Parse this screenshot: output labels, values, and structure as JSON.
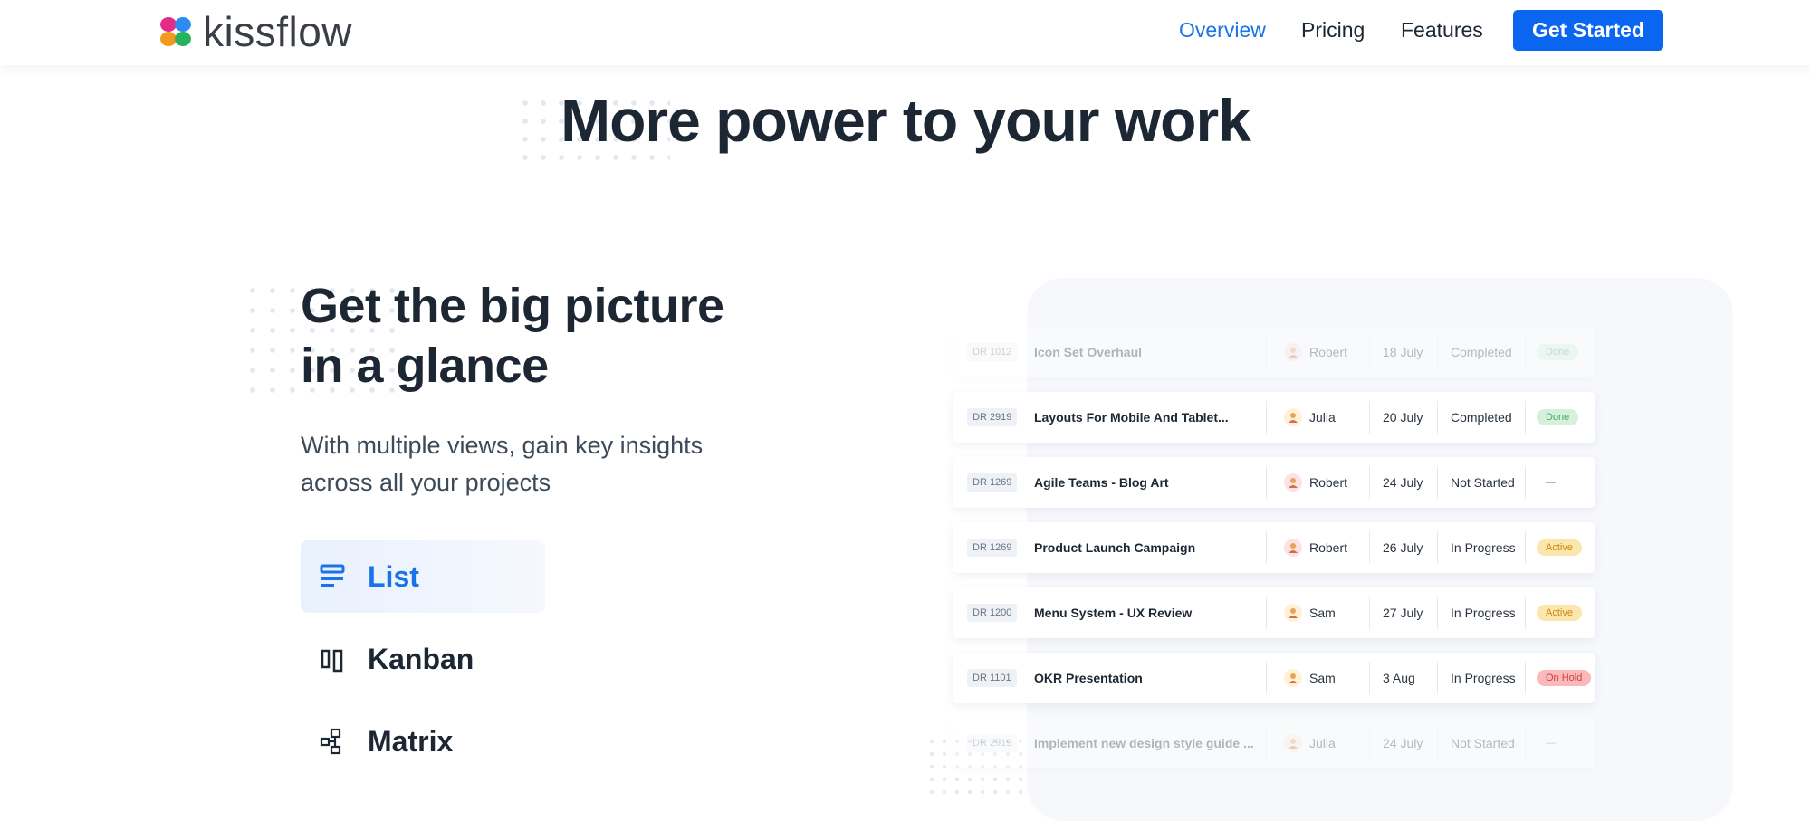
{
  "header": {
    "logo_text": "kissflow",
    "nav": [
      "Overview",
      "Pricing",
      "Features"
    ],
    "cta_label": "Get Started"
  },
  "hero": {
    "title": "More power to your work"
  },
  "feature": {
    "title_line1": "Get the big picture",
    "title_line2": "in a glance",
    "subtitle_line1": "With multiple views, gain key insights",
    "subtitle_line2": "across all your projects"
  },
  "views": [
    {
      "label": "List",
      "icon": "list-icon",
      "active": true
    },
    {
      "label": "Kanban",
      "icon": "kanban-icon",
      "active": false
    },
    {
      "label": "Matrix",
      "icon": "matrix-icon",
      "active": false
    }
  ],
  "tasks": [
    {
      "id": "DR 1012",
      "title": "Icon Set Overhaul",
      "owner": "Robert",
      "date": "18 July",
      "status": "Completed",
      "badge": "Done",
      "faded": true
    },
    {
      "id": "DR 2919",
      "title": "Layouts For Mobile And Tablet...",
      "owner": "Julia",
      "date": "20 July",
      "status": "Completed",
      "badge": "Done",
      "faded": false
    },
    {
      "id": "DR 1269",
      "title": "Agile Teams - Blog Art",
      "owner": "Robert",
      "date": "24 July",
      "status": "Not Started",
      "badge": "—",
      "faded": false
    },
    {
      "id": "DR 1269",
      "title": "Product Launch Campaign",
      "owner": "Robert",
      "date": "26 July",
      "status": "In Progress",
      "badge": "Active",
      "faded": false
    },
    {
      "id": "DR 1200",
      "title": "Menu System - UX Review",
      "owner": "Sam",
      "date": "27 July",
      "status": "In Progress",
      "badge": "Active",
      "faded": false
    },
    {
      "id": "DR 1101",
      "title": "OKR Presentation",
      "owner": "Sam",
      "date": "3 Aug",
      "status": "In Progress",
      "badge": "On Hold",
      "faded": false
    },
    {
      "id": "DR 2919",
      "title": "Implement new design style guide ...",
      "owner": "Julia",
      "date": "24 July",
      "status": "Not Started",
      "badge": "—",
      "faded": true
    }
  ],
  "colors": {
    "accent": "#1a73e8",
    "cta": "#0a66f0",
    "badge_done_bg": "#d5f1dc",
    "badge_done_fg": "#4aa565",
    "badge_active_bg": "#fde6ae",
    "badge_active_fg": "#c98a12",
    "badge_hold_bg": "#fbb9b9",
    "badge_hold_fg": "#c94040"
  }
}
